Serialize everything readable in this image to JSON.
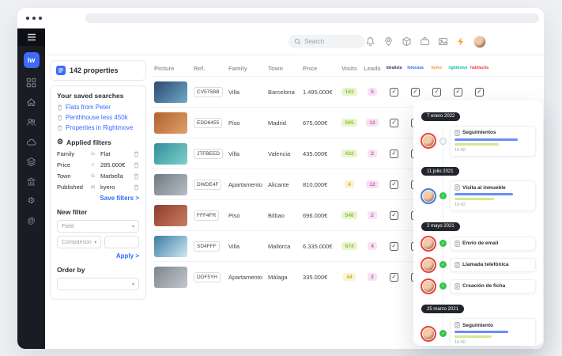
{
  "sidebar": {
    "logo_text": "iw",
    "icons": [
      "menu-icon",
      "grid-icon",
      "home-icon",
      "users-icon",
      "cloud-icon",
      "layers-icon",
      "bank-icon",
      "gear-icon",
      "at-icon"
    ]
  },
  "topbar": {
    "search_placeholder": "Search",
    "icons": [
      "search-icon",
      "bell-icon",
      "map-pin-icon",
      "package-icon",
      "briefcase-icon",
      "image-icon",
      "flash-icon",
      "avatar"
    ]
  },
  "filters_panel": {
    "count_label": "142 properties",
    "saved_title": "Your saved searches",
    "saved_searches": [
      "Flats from Peter",
      "Penthhouse less 450k",
      "Properties in Rightmove"
    ],
    "applied_title": "Applied filters",
    "applied": [
      {
        "field": "Family",
        "op": "is",
        "value": "Flat"
      },
      {
        "field": "Price",
        "op": "<",
        "value": "285.000€"
      },
      {
        "field": "Town",
        "op": "is",
        "value": "Marbella"
      },
      {
        "field": "Published",
        "op": "at",
        "value": "kyero"
      }
    ],
    "save_filters_link": "Save filters >",
    "new_filter_title": "New filter",
    "field_placeholder": "Field",
    "comparison_placeholder": "Comparison",
    "value_placeholder": "",
    "apply_link": "Apply >",
    "order_by_title": "Order by",
    "order_by_placeholder": ""
  },
  "table": {
    "columns": [
      "Picture",
      "Ref.",
      "Family",
      "Town",
      "Price",
      "Visits",
      "Leads"
    ],
    "portals": [
      {
        "name": "idealista",
        "color": "#33366e"
      },
      {
        "name": "fotocasa",
        "color": "#2f6bff"
      },
      {
        "name": "kyero",
        "color": "#ff8c1a"
      },
      {
        "name": "rightmove",
        "color": "#00c2a8"
      },
      {
        "name": "habitaclia",
        "color": "#e9434d"
      }
    ],
    "rows": [
      {
        "ref": "CV575BB",
        "family": "Villa",
        "town": "Barcelona",
        "price": "1.495.000€",
        "visits": "163",
        "visits_level": "high",
        "leads": "5",
        "photo": [
          "#2c4a6e",
          "#6fa8c9"
        ],
        "portals": [
          true,
          true,
          true,
          true,
          true
        ]
      },
      {
        "ref": "EDD6455",
        "family": "Piso",
        "town": "Madrid",
        "price": "675.000€",
        "visits": "565",
        "visits_level": "high",
        "leads": "12",
        "photo": [
          "#b0622f",
          "#e0a067"
        ],
        "portals": [
          true,
          true,
          true,
          true,
          true
        ]
      },
      {
        "ref": "JTFBEED",
        "family": "Villa",
        "town": "Valencia",
        "price": "435.000€",
        "visits": "432",
        "visits_level": "high",
        "leads": "2",
        "photo": [
          "#2e8f99",
          "#7fd0c9"
        ],
        "portals": [
          true,
          true,
          true,
          true,
          true
        ]
      },
      {
        "ref": "DWDE4F",
        "family": "Apartamento",
        "town": "Alicante",
        "price": "810.000€",
        "visits": "4",
        "visits_level": "low",
        "leads": "12",
        "photo": [
          "#6e7a84",
          "#b5bec4"
        ],
        "portals": [
          true,
          true,
          true,
          true,
          true
        ]
      },
      {
        "ref": "FFF4FR",
        "family": "Piso",
        "town": "Bilbao",
        "price": "696.000€",
        "visits": "546",
        "visits_level": "high",
        "leads": "2",
        "photo": [
          "#8e3b2f",
          "#c97f5f"
        ],
        "portals": [
          true,
          true,
          true,
          true,
          true
        ]
      },
      {
        "ref": "SD4FFF",
        "family": "Villa",
        "town": "Mallorca",
        "price": "6.335.000€",
        "visits": "674",
        "visits_level": "high",
        "leads": "4",
        "photo": [
          "#3a7ca5",
          "#cfe8f0"
        ],
        "portals": [
          true,
          true,
          true,
          true,
          true
        ]
      },
      {
        "ref": "DDF5YH",
        "family": "Apartamento",
        "town": "Málaga",
        "price": "335.000€",
        "visits": "44",
        "visits_level": "low",
        "leads": "2",
        "photo": [
          "#7d848c",
          "#c2c8cd"
        ],
        "portals": [
          true,
          true,
          true,
          true,
          true
        ]
      }
    ]
  },
  "timeline": {
    "groups": [
      {
        "date": "7 enero 2022",
        "items": [
          {
            "title": "Seguimientos",
            "icon": "clipboard-icon",
            "ring": "red",
            "status": "pending",
            "progress": [
              82,
              58
            ],
            "time": "15:40"
          }
        ]
      },
      {
        "date": "11 julio 2021",
        "items": [
          {
            "title": "Visita al inmueble",
            "icon": "map-pin-icon",
            "ring": "blue",
            "status": "done",
            "progress": [
              76,
              52
            ],
            "time": "10:42"
          }
        ]
      },
      {
        "date": "2 mayo 2021",
        "items": [
          {
            "title": "Envío de email",
            "icon": "mail-icon",
            "ring": "red",
            "status": "done"
          },
          {
            "title": "Llamada telefónica",
            "icon": "phone-icon",
            "ring": "red",
            "status": "done"
          },
          {
            "title": "Creación de ficha",
            "icon": "file-icon",
            "ring": "red",
            "status": "done"
          }
        ]
      },
      {
        "date": "25 marzo 2021",
        "items": [
          {
            "title": "Seguimiento",
            "icon": "clipboard-icon",
            "ring": "red",
            "status": "done",
            "progress": [
              70,
              48
            ],
            "time": "16:40"
          }
        ]
      }
    ]
  },
  "colors": {
    "accent_blue": "#3d6bfa",
    "link_blue": "#2f6bff",
    "flash_orange": "#f7a325",
    "badge_green_bg": "#e9f5cf",
    "badge_green_text": "#93c13c",
    "badge_yellow_bg": "#fbf3cf",
    "badge_yellow_text": "#c9ae3a",
    "badge_pink_bg": "#f8e2f2",
    "badge_pink_text": "#c35faf",
    "ring_red": "#e8453c",
    "ring_blue": "#3f7de0",
    "done_green": "#37c24a"
  }
}
